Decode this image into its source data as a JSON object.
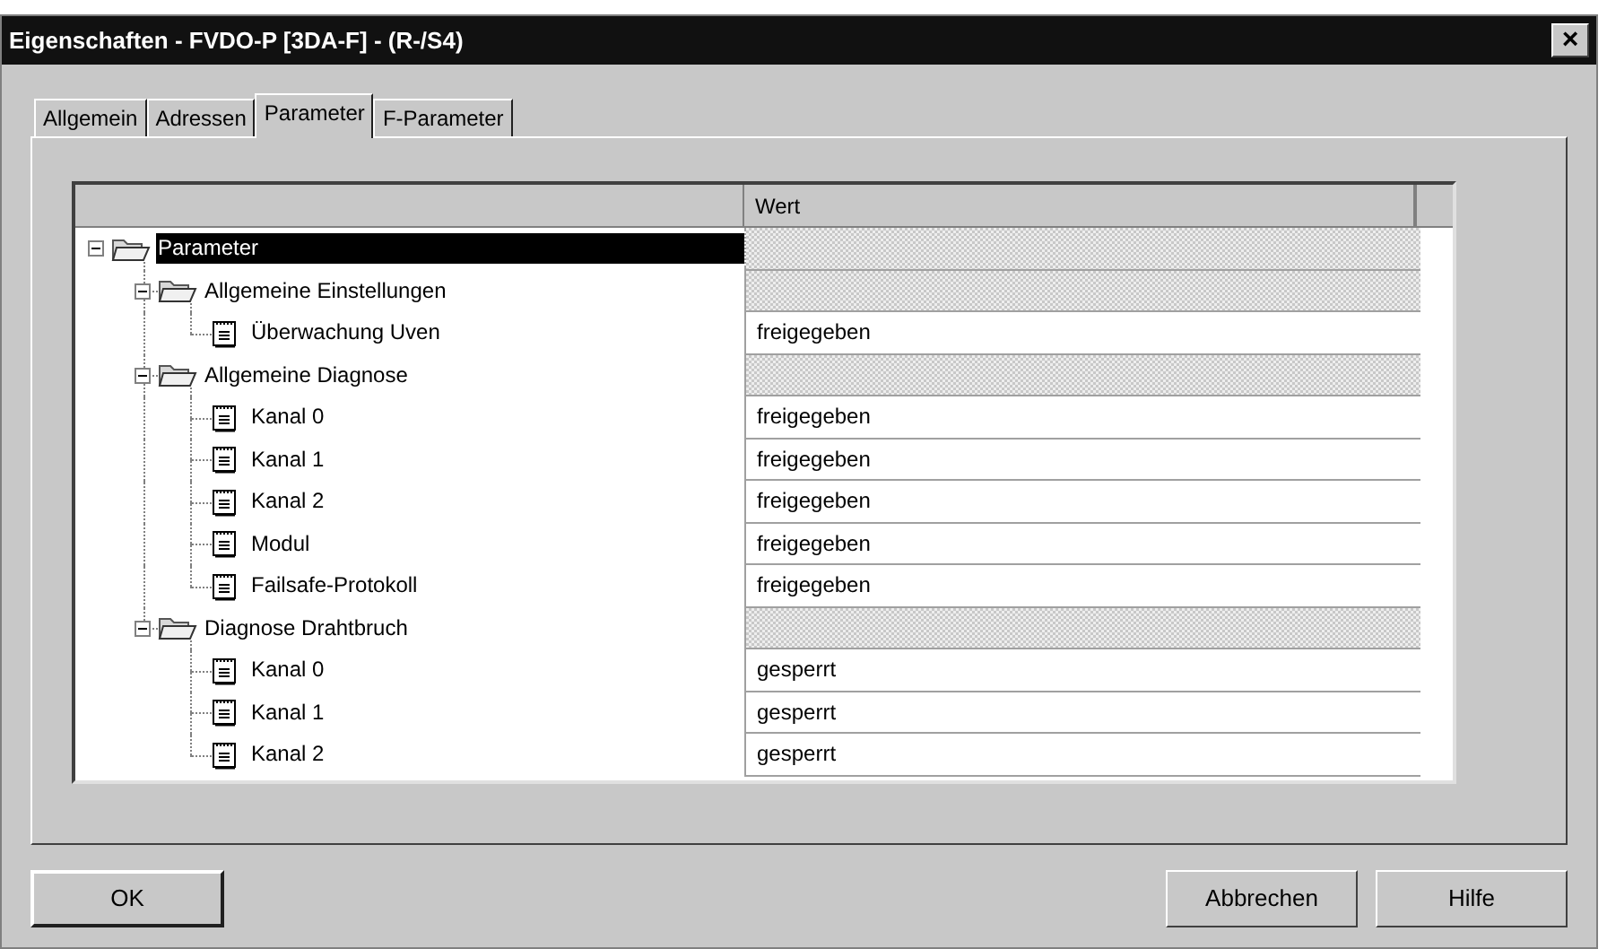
{
  "window": {
    "title": "Eigenschaften - FVDO-P [3DA-F] - (R-/S4)",
    "close": "×"
  },
  "tabs": [
    {
      "label": "Allgemein",
      "selected": false
    },
    {
      "label": "Adressen",
      "selected": false
    },
    {
      "label": "Parameter",
      "selected": true
    },
    {
      "label": "F-Parameter",
      "selected": false
    }
  ],
  "table": {
    "columns": [
      "Wert"
    ],
    "tree": [
      {
        "kind": "group",
        "label": "Parameter",
        "selected": true,
        "expanded": true,
        "children": [
          {
            "kind": "group",
            "label": "Allgemeine Einstellungen",
            "selected": false,
            "expanded": true,
            "children": [
              {
                "kind": "param",
                "label": "Überwachung Uven",
                "selected": false,
                "value": "freigegeben"
              }
            ]
          },
          {
            "kind": "group",
            "label": "Allgemeine Diagnose",
            "selected": false,
            "expanded": true,
            "children": [
              {
                "kind": "param",
                "label": "Kanal 0",
                "selected": false,
                "value": "freigegeben"
              },
              {
                "kind": "param",
                "label": "Kanal 1",
                "selected": false,
                "value": "freigegeben"
              },
              {
                "kind": "param",
                "label": "Kanal 2",
                "selected": false,
                "value": "freigegeben"
              },
              {
                "kind": "param",
                "label": "Modul",
                "selected": false,
                "value": "freigegeben"
              },
              {
                "kind": "param",
                "label": "Failsafe-Protokoll",
                "selected": false,
                "value": "freigegeben"
              }
            ]
          },
          {
            "kind": "group",
            "label": "Diagnose Drahtbruch",
            "selected": false,
            "expanded": true,
            "children": [
              {
                "kind": "param",
                "label": "Kanal 0",
                "selected": false,
                "value": "gesperrt"
              },
              {
                "kind": "param",
                "label": "Kanal 1",
                "selected": false,
                "value": "gesperrt"
              },
              {
                "kind": "param",
                "label": "Kanal 2",
                "selected": false,
                "value": "gesperrt"
              }
            ]
          }
        ]
      }
    ]
  },
  "buttons": [
    "OK",
    "Abbrechen",
    "Hilfe"
  ]
}
